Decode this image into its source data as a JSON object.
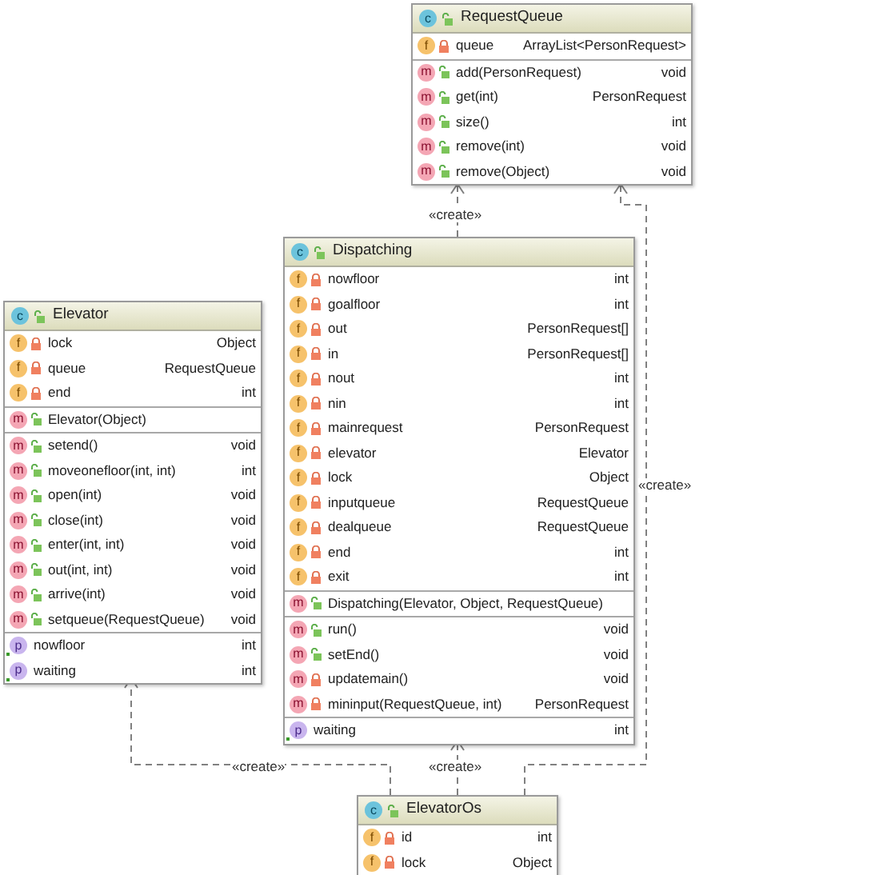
{
  "classes": [
    {
      "badge": "c",
      "name": "RequestQueue",
      "private": false,
      "sections": [
        [
          {
            "kind": "field",
            "badge": "f",
            "private": true,
            "name": "queue",
            "type": "ArrayList<PersonRequest>"
          }
        ],
        [
          {
            "kind": "method",
            "badge": "m",
            "private": false,
            "name": "add(PersonRequest)",
            "type": "void"
          },
          {
            "kind": "method",
            "badge": "m",
            "private": false,
            "name": "get(int)",
            "type": "PersonRequest"
          },
          {
            "kind": "method",
            "badge": "m",
            "private": false,
            "name": "size()",
            "type": "int"
          },
          {
            "kind": "method",
            "badge": "m",
            "private": false,
            "name": "remove(int)",
            "type": "void"
          },
          {
            "kind": "method",
            "badge": "m",
            "private": false,
            "name": "remove(Object)",
            "type": "void"
          }
        ]
      ]
    },
    {
      "badge": "c",
      "name": "Elevator",
      "private": false,
      "sections": [
        [
          {
            "kind": "field",
            "badge": "f",
            "private": true,
            "name": "lock",
            "type": "Object"
          },
          {
            "kind": "field",
            "badge": "f",
            "private": true,
            "name": "queue",
            "type": "RequestQueue"
          },
          {
            "kind": "field",
            "badge": "f",
            "private": true,
            "name": "end",
            "type": "int"
          }
        ],
        [
          {
            "kind": "method",
            "badge": "m",
            "private": false,
            "name": "Elevator(Object)"
          }
        ],
        [
          {
            "kind": "method",
            "badge": "m",
            "private": false,
            "name": "setend()",
            "type": "void"
          },
          {
            "kind": "method",
            "badge": "m",
            "private": false,
            "name": "moveonefloor(int, int)",
            "type": "int"
          },
          {
            "kind": "method",
            "badge": "m",
            "private": false,
            "name": "open(int)",
            "type": "void"
          },
          {
            "kind": "method",
            "badge": "m",
            "private": false,
            "name": "close(int)",
            "type": "void"
          },
          {
            "kind": "method",
            "badge": "m",
            "private": false,
            "name": "enter(int, int)",
            "type": "void"
          },
          {
            "kind": "method",
            "badge": "m",
            "private": false,
            "name": "out(int, int)",
            "type": "void"
          },
          {
            "kind": "method",
            "badge": "m",
            "private": false,
            "name": "arrive(int)",
            "type": "void"
          },
          {
            "kind": "method",
            "badge": "m",
            "private": false,
            "name": "setqueue(RequestQueue)",
            "type": "void"
          }
        ],
        [
          {
            "kind": "property",
            "badge": "p",
            "name": "nowfloor",
            "type": "int"
          },
          {
            "kind": "property",
            "badge": "p",
            "name": "waiting",
            "type": "int"
          }
        ]
      ]
    },
    {
      "badge": "c",
      "name": "Dispatching",
      "private": false,
      "sections": [
        [
          {
            "kind": "field",
            "badge": "f",
            "private": true,
            "name": "nowfloor",
            "type": "int"
          },
          {
            "kind": "field",
            "badge": "f",
            "private": true,
            "name": "goalfloor",
            "type": "int"
          },
          {
            "kind": "field",
            "badge": "f",
            "private": true,
            "name": "out",
            "type": "PersonRequest[]"
          },
          {
            "kind": "field",
            "badge": "f",
            "private": true,
            "name": "in",
            "type": "PersonRequest[]"
          },
          {
            "kind": "field",
            "badge": "f",
            "private": true,
            "name": "nout",
            "type": "int"
          },
          {
            "kind": "field",
            "badge": "f",
            "private": true,
            "name": "nin",
            "type": "int"
          },
          {
            "kind": "field",
            "badge": "f",
            "private": true,
            "name": "mainrequest",
            "type": "PersonRequest"
          },
          {
            "kind": "field",
            "badge": "f",
            "private": true,
            "name": "elevator",
            "type": "Elevator"
          },
          {
            "kind": "field",
            "badge": "f",
            "private": true,
            "name": "lock",
            "type": "Object"
          },
          {
            "kind": "field",
            "badge": "f",
            "private": true,
            "name": "inputqueue",
            "type": "RequestQueue"
          },
          {
            "kind": "field",
            "badge": "f",
            "private": true,
            "name": "dealqueue",
            "type": "RequestQueue"
          },
          {
            "kind": "field",
            "badge": "f",
            "private": true,
            "name": "end",
            "type": "int"
          },
          {
            "kind": "field",
            "badge": "f",
            "private": true,
            "name": "exit",
            "type": "int"
          }
        ],
        [
          {
            "kind": "method",
            "badge": "m",
            "private": false,
            "name": "Dispatching(Elevator, Object, RequestQueue)"
          }
        ],
        [
          {
            "kind": "method",
            "badge": "m",
            "private": false,
            "name": "run()",
            "type": "void"
          },
          {
            "kind": "method",
            "badge": "m",
            "private": false,
            "name": "setEnd()",
            "type": "void"
          },
          {
            "kind": "method",
            "badge": "m",
            "private": true,
            "name": "updatemain()",
            "type": "void"
          },
          {
            "kind": "method",
            "badge": "m",
            "private": true,
            "name": "mininput(RequestQueue, int)",
            "type": "PersonRequest"
          }
        ],
        [
          {
            "kind": "property",
            "badge": "p",
            "name": "waiting",
            "type": "int"
          }
        ]
      ]
    },
    {
      "badge": "c",
      "name": "ElevatorOs",
      "private": false,
      "sections": [
        [
          {
            "kind": "field",
            "badge": "f",
            "private": true,
            "name": "id",
            "type": "int"
          },
          {
            "kind": "field",
            "badge": "f",
            "private": true,
            "name": "lock",
            "type": "Object"
          }
        ]
      ]
    }
  ],
  "edges": [
    {
      "label": "«create»"
    },
    {
      "label": "«create»"
    },
    {
      "label": "«create»"
    },
    {
      "label": "«create»"
    }
  ]
}
